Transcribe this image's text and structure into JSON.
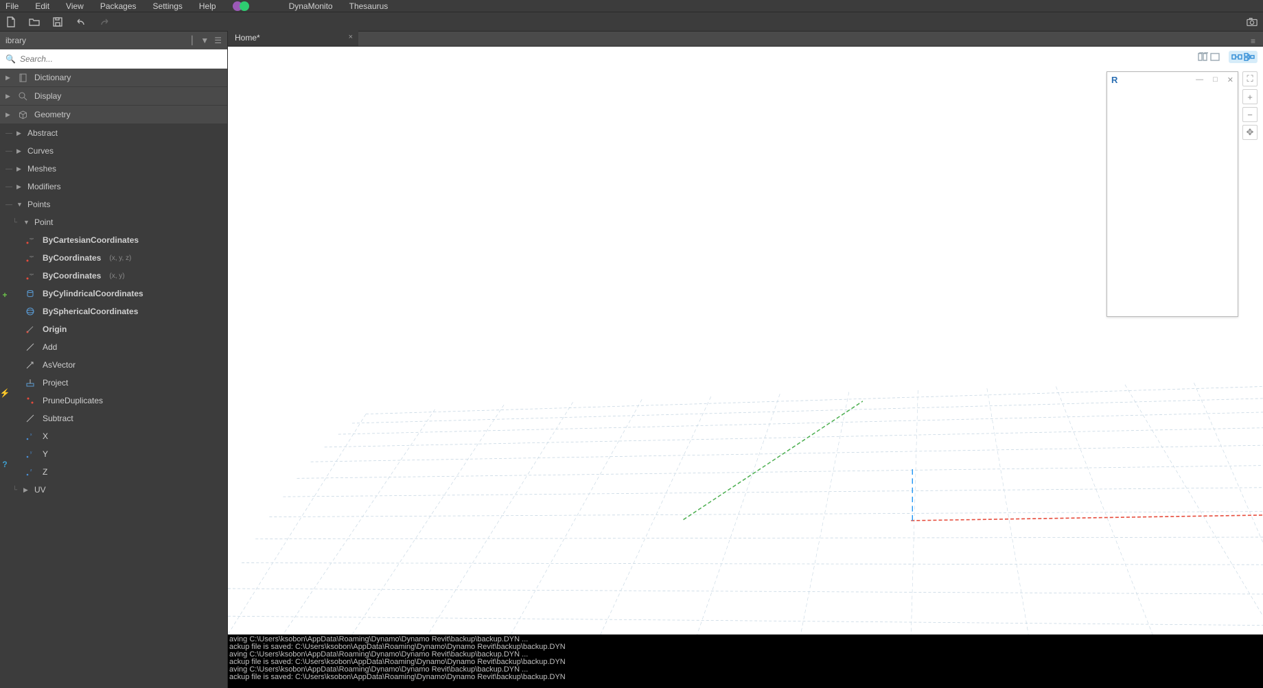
{
  "menu": {
    "items": [
      "File",
      "Edit",
      "View",
      "Packages",
      "Settings",
      "Help"
    ],
    "plugins": [
      "DynaMonito",
      "Thesaurus"
    ]
  },
  "toolbar": {
    "icons": [
      "new-file",
      "open-file",
      "save-file",
      "undo",
      "redo"
    ]
  },
  "library": {
    "title": "ibrary",
    "search_placeholder": "Search...",
    "categories": [
      {
        "label": "Dictionary",
        "icon": "book"
      },
      {
        "label": "Display",
        "icon": "magnify"
      },
      {
        "label": "Geometry",
        "icon": "cube",
        "expanded": true
      }
    ],
    "geometry_sub": [
      {
        "label": "Abstract",
        "expanded": false
      },
      {
        "label": "Curves",
        "expanded": false
      },
      {
        "label": "Meshes",
        "expanded": false
      },
      {
        "label": "Modifiers",
        "expanded": false
      },
      {
        "label": "Points",
        "expanded": true
      }
    ],
    "points_sub": [
      {
        "label": "Point",
        "expanded": true
      }
    ],
    "point_create": [
      {
        "label": "ByCartesianCoordinates",
        "icon": "xyz",
        "bold": true
      },
      {
        "label": "ByCoordinates",
        "hint": "(x, y, z)",
        "icon": "xyz",
        "bold": true
      },
      {
        "label": "ByCoordinates",
        "hint": "(x, y)",
        "icon": "xyz",
        "bold": true
      },
      {
        "label": "ByCylindricalCoordinates",
        "icon": "cyl",
        "bold": true
      },
      {
        "label": "BySphericalCoordinates",
        "icon": "sph",
        "bold": true
      },
      {
        "label": "Origin",
        "icon": "origin",
        "bold": true
      }
    ],
    "point_action": [
      {
        "label": "Add",
        "icon": "line"
      },
      {
        "label": "AsVector",
        "icon": "vector"
      },
      {
        "label": "Project",
        "icon": "project"
      },
      {
        "label": "PruneDuplicates",
        "icon": "prune"
      },
      {
        "label": "Subtract",
        "icon": "line"
      }
    ],
    "point_query": [
      {
        "label": "X",
        "icon": "axis-x"
      },
      {
        "label": "Y",
        "icon": "axis-y"
      },
      {
        "label": "Z",
        "icon": "axis-z"
      }
    ],
    "points_other": [
      {
        "label": "UV",
        "expanded": false
      }
    ],
    "rail_symbols": {
      "create": "+",
      "action": "⚡",
      "query": "?"
    }
  },
  "tab": {
    "title": "Home*",
    "close": "×"
  },
  "float_panel": {
    "logo": "R"
  },
  "nav_buttons": [
    "⛶",
    "+",
    "−",
    "✥"
  ],
  "console_lines": [
    "aving C:\\Users\\ksobon\\AppData\\Roaming\\Dynamo\\Dynamo Revit\\backup\\backup.DYN ...",
    "ackup file is saved: C:\\Users\\ksobon\\AppData\\Roaming\\Dynamo\\Dynamo Revit\\backup\\backup.DYN",
    "aving C:\\Users\\ksobon\\AppData\\Roaming\\Dynamo\\Dynamo Revit\\backup\\backup.DYN ...",
    "ackup file is saved: C:\\Users\\ksobon\\AppData\\Roaming\\Dynamo\\Dynamo Revit\\backup\\backup.DYN",
    "aving C:\\Users\\ksobon\\AppData\\Roaming\\Dynamo\\Dynamo Revit\\backup\\backup.DYN ...",
    "ackup file is saved: C:\\Users\\ksobon\\AppData\\Roaming\\Dynamo\\Dynamo Revit\\backup\\backup.DYN"
  ]
}
